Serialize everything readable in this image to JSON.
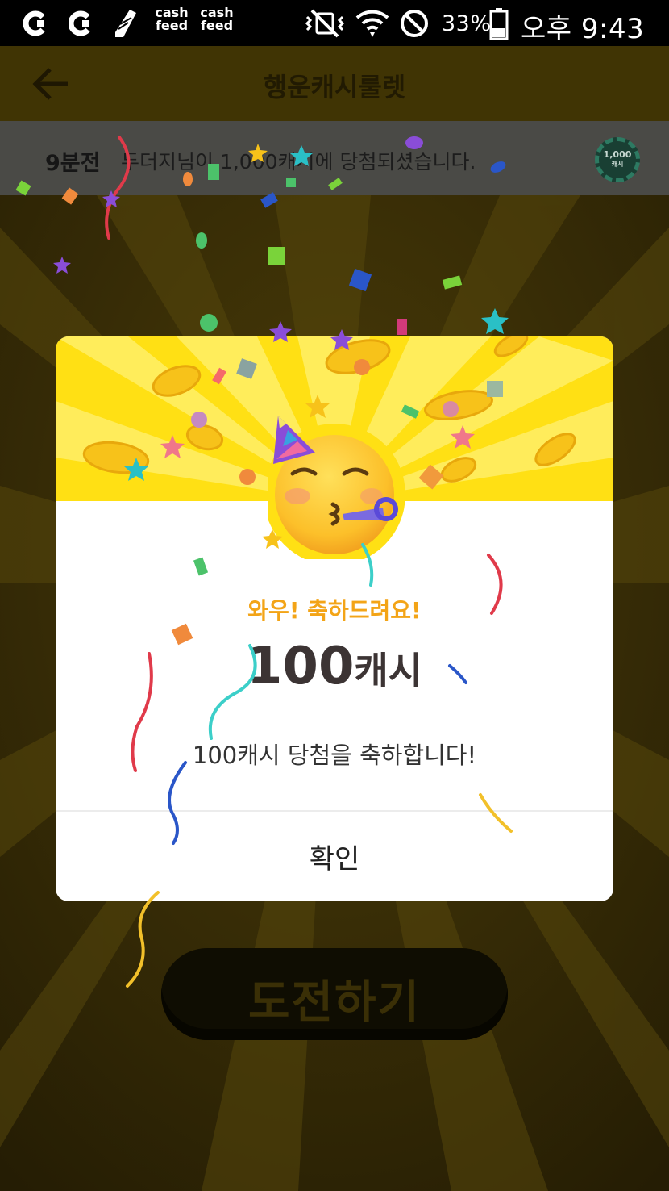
{
  "status_bar": {
    "notification_icons": [
      "cashfeed-c-icon",
      "cashfeed-c-icon",
      "shoe-icon",
      "cashfeed-icon",
      "cashfeed-icon"
    ],
    "cashfeed_label_top": "cash",
    "cashfeed_label_bottom": "feed",
    "battery_percent": "33%",
    "time": "오후 9:43"
  },
  "app_bar": {
    "title": "행운캐시룰렛",
    "back_icon": "arrow-left-icon"
  },
  "ticker": {
    "time_ago": "9분전",
    "message": "두더지님이 1,000캐시에 당첨되셨습니다.",
    "chip_value": "1,000",
    "chip_unit": "캐시"
  },
  "dialog": {
    "emoji": "partying-face-icon",
    "title": "와우! 축하드려요!",
    "amount": "100",
    "amount_unit": "캐시",
    "message": "100캐시 당첨을 축하합니다!",
    "confirm_label": "확인"
  },
  "challenge_button": {
    "label": "도전하기"
  },
  "colors": {
    "accent_yellow": "#ffe014",
    "title_orange": "#f3a417",
    "amount_text": "#3c3434",
    "overlay_bg": "#2b2206"
  }
}
